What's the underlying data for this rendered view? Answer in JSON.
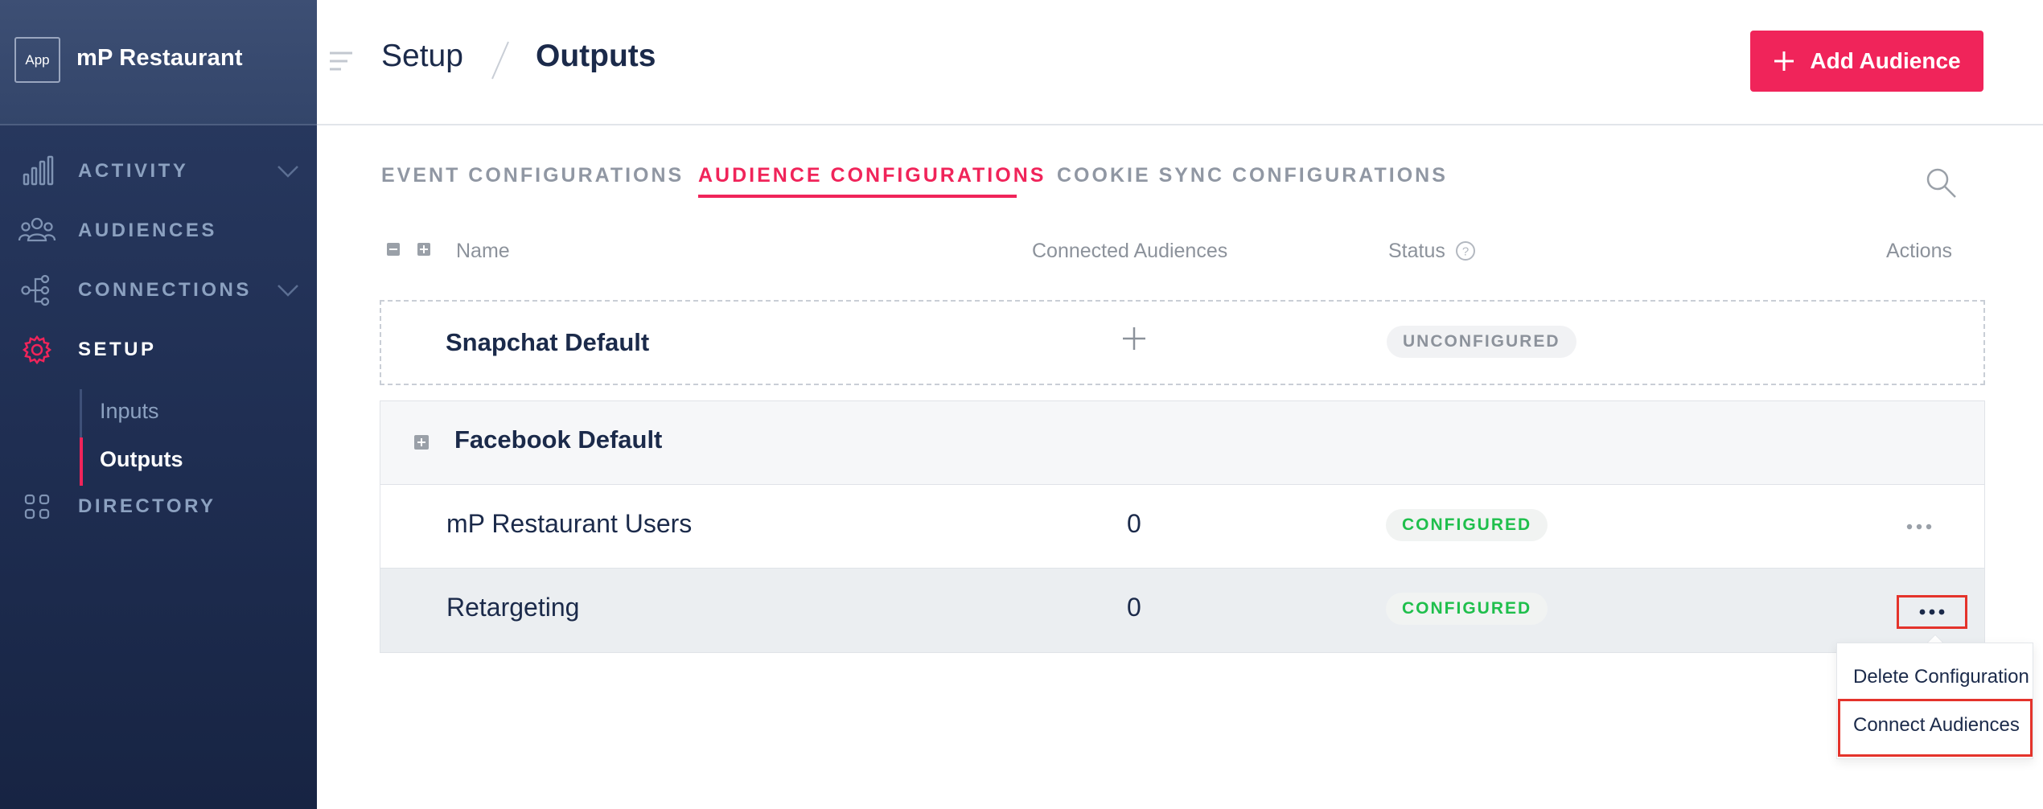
{
  "app": {
    "badge": "App",
    "name": "mP Restaurant"
  },
  "sidebar": {
    "items": [
      {
        "label": "ACTIVITY",
        "icon": "bar-chart-icon",
        "has_chevron": true
      },
      {
        "label": "AUDIENCES",
        "icon": "people-icon",
        "has_chevron": false
      },
      {
        "label": "CONNECTIONS",
        "icon": "connections-icon",
        "has_chevron": true
      },
      {
        "label": "SETUP",
        "icon": "gear-icon",
        "active": true
      },
      {
        "label": "DIRECTORY",
        "icon": "grid-icon",
        "has_chevron": false
      }
    ],
    "setup_sub": [
      {
        "label": "Inputs"
      },
      {
        "label": "Outputs",
        "active": true
      }
    ]
  },
  "header": {
    "breadcrumb_parent": "Setup",
    "breadcrumb_current": "Outputs",
    "add_button": "Add Audience"
  },
  "tabs": [
    {
      "label": "EVENT CONFIGURATIONS"
    },
    {
      "label": "AUDIENCE CONFIGURATIONS",
      "active": true
    },
    {
      "label": "COOKIE SYNC CONFIGURATIONS"
    }
  ],
  "table": {
    "columns": {
      "name": "Name",
      "connected": "Connected Audiences",
      "status": "Status",
      "actions": "Actions"
    },
    "snapchat": {
      "name": "Snapchat Default",
      "status": "UNCONFIGURED"
    },
    "facebook": {
      "name": "Facebook Default",
      "rows": [
        {
          "name": "mP Restaurant Users",
          "count": "0",
          "status": "CONFIGURED"
        },
        {
          "name": "Retargeting",
          "count": "0",
          "status": "CONFIGURED"
        }
      ]
    }
  },
  "action_menu": {
    "items": [
      "Delete Configuration",
      "Connect Audiences"
    ]
  },
  "colors": {
    "accent": "#f0245a",
    "sidebar": "#1f2e52",
    "configured": "#1fbf4c",
    "highlight": "#e4332b"
  }
}
